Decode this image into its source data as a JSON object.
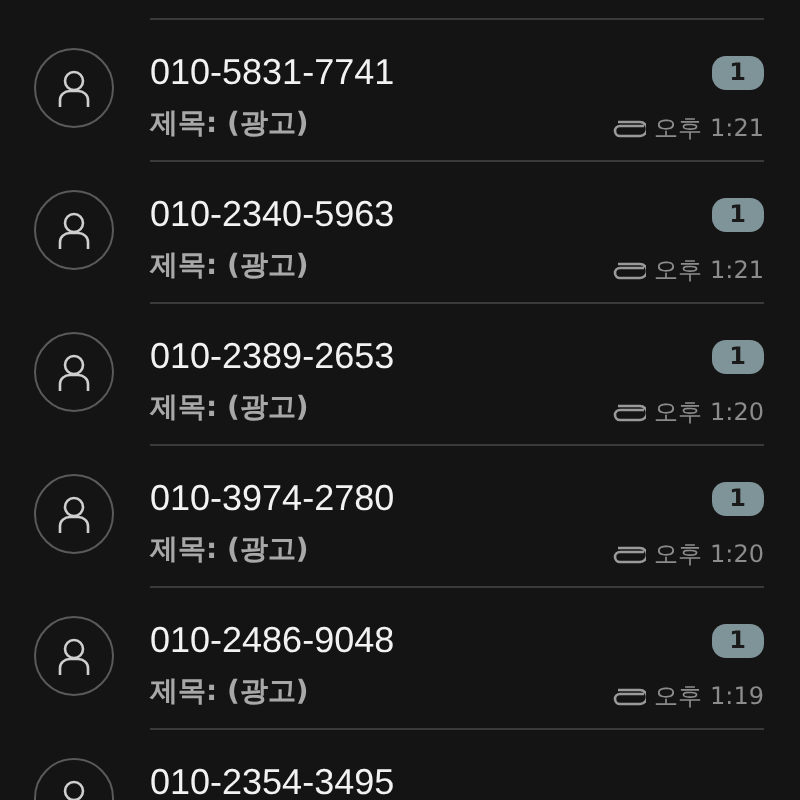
{
  "messages": [
    {
      "sender": "010-5831-7741",
      "subject": "제목: (광고)",
      "unread": "1",
      "attachment": true,
      "time": "오후 1:21"
    },
    {
      "sender": "010-2340-5963",
      "subject": "제목: (광고)",
      "unread": "1",
      "attachment": true,
      "time": "오후 1:21"
    },
    {
      "sender": "010-2389-2653",
      "subject": "제목: (광고)",
      "unread": "1",
      "attachment": true,
      "time": "오후 1:20"
    },
    {
      "sender": "010-3974-2780",
      "subject": "제목: (광고)",
      "unread": "1",
      "attachment": true,
      "time": "오후 1:20"
    },
    {
      "sender": "010-2486-9048",
      "subject": "제목: (광고)",
      "unread": "1",
      "attachment": true,
      "time": "오후 1:19"
    },
    {
      "sender": "010-2354-3495"
    }
  ]
}
